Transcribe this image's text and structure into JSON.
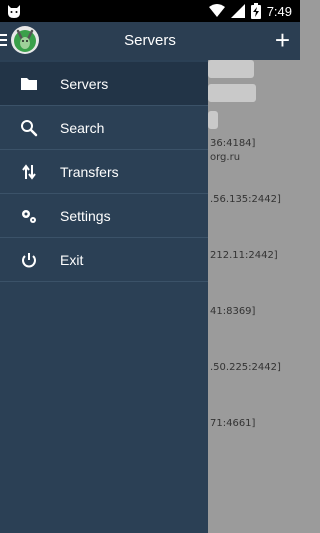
{
  "status_bar": {
    "time": "7:49",
    "battery_icon": "battery-charging-icon",
    "wifi_icon": "wifi-icon",
    "signal_icon": "signal-icon"
  },
  "app_bar": {
    "title": "Servers",
    "add_icon": "plus-icon"
  },
  "drawer": {
    "items": [
      {
        "label": "Servers",
        "icon": "folder-icon",
        "active": true
      },
      {
        "label": "Search",
        "icon": "search-icon",
        "active": false
      },
      {
        "label": "Transfers",
        "icon": "transfer-arrows-icon",
        "active": false
      },
      {
        "label": "Settings",
        "icon": "gear-icon",
        "active": false
      },
      {
        "label": "Exit",
        "icon": "power-icon",
        "active": false
      }
    ]
  },
  "background_list": {
    "rows": [
      {
        "text": "36:4184]"
      },
      {
        "text": "org.ru"
      },
      {
        "text": ".56.135:2442]"
      },
      {
        "text": "212.11:2442]"
      },
      {
        "text": "41:8369]"
      },
      {
        "text": ".50.225:2442]"
      },
      {
        "text": "71:4661]"
      }
    ]
  },
  "colors": {
    "app_bar": "#2b3e52",
    "drawer": "#2b4055",
    "drawer_active": "#223447",
    "background": "#9b9b9b"
  }
}
